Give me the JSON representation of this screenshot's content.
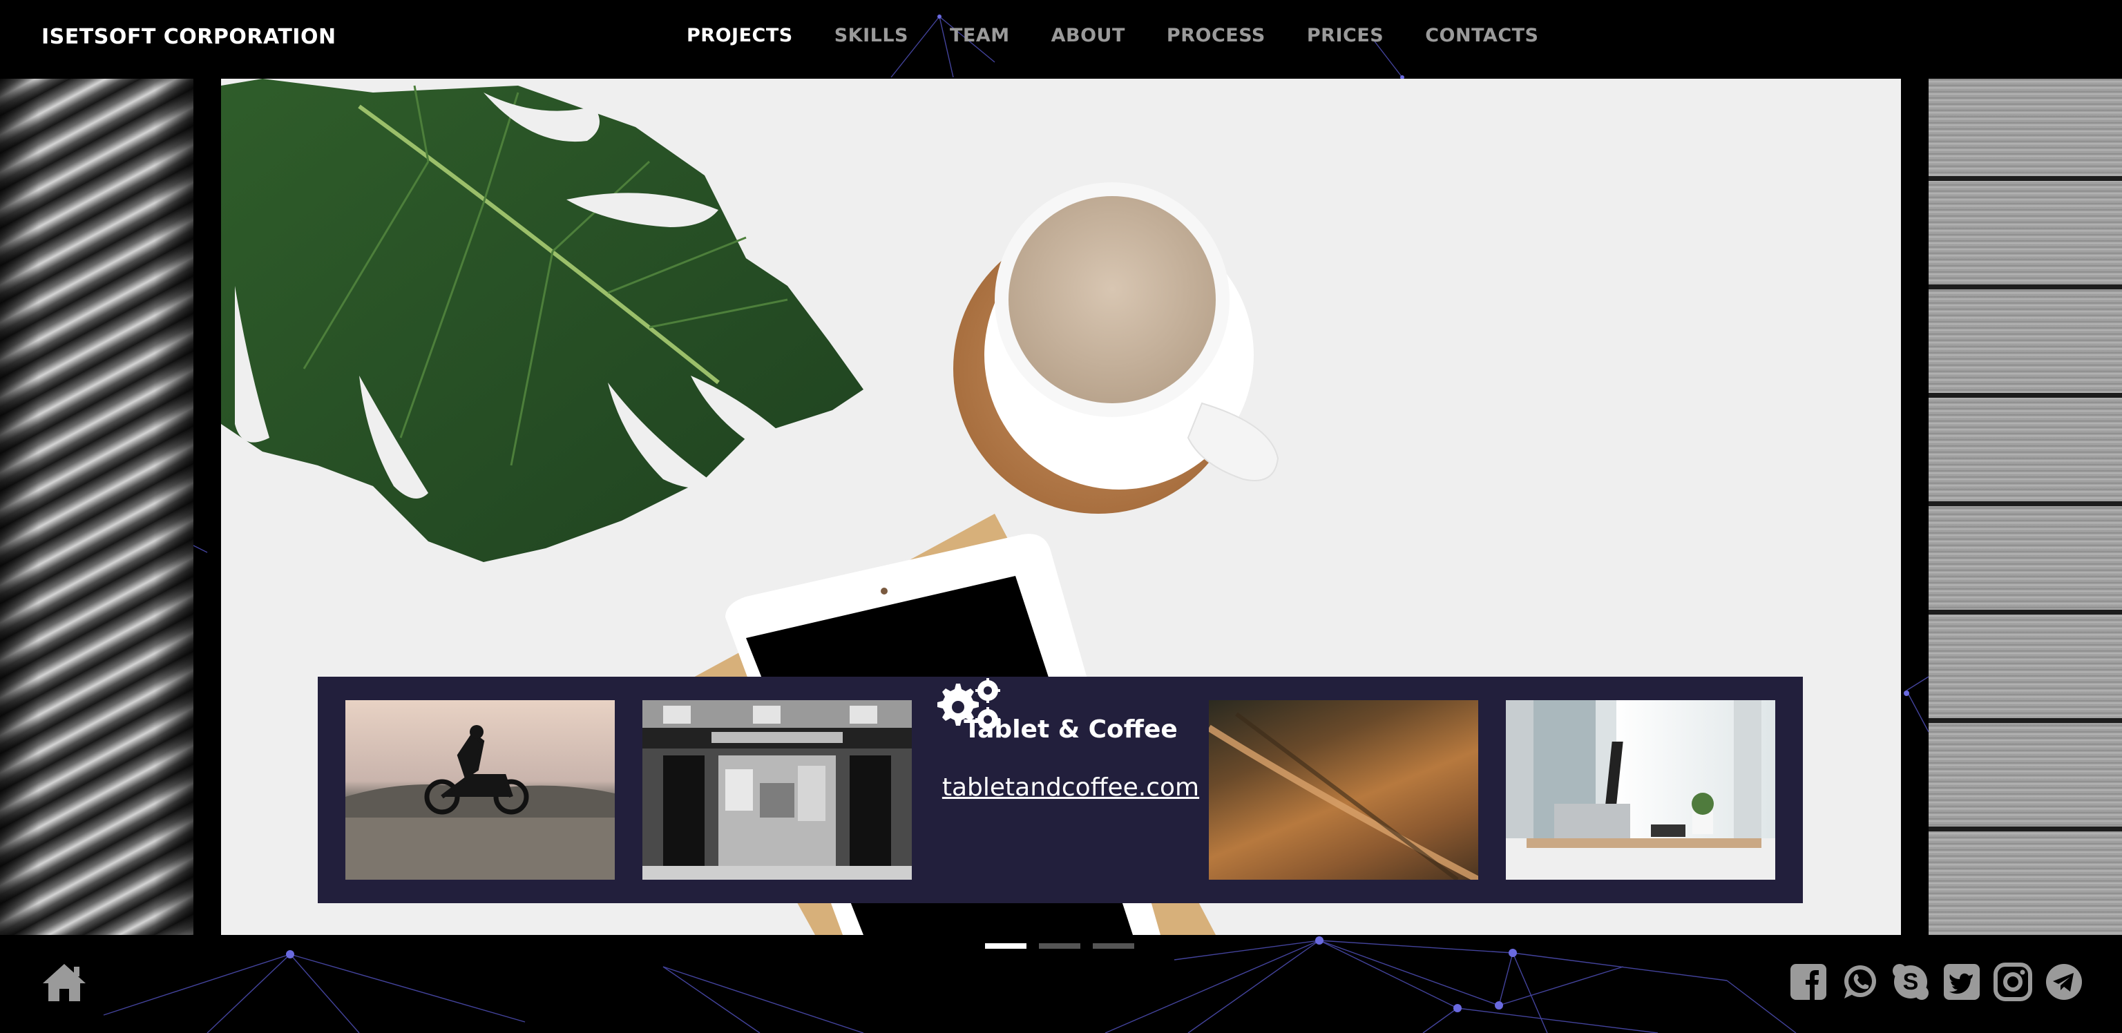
{
  "header": {
    "logo": "ISETSOFT CORPORATION",
    "nav": [
      "PROJECTS",
      "SKILLS",
      "TEAM",
      "ABOUT",
      "PROCESS",
      "PRICES",
      "CONTACTS"
    ],
    "active_nav": "PROJECTS"
  },
  "project": {
    "title": "Tablet & Coffee",
    "link": "tabletandcoffee.com"
  },
  "carousel": {
    "slide_count": 3,
    "active_slide": 1
  },
  "footer": {
    "home_icon": "home-icon",
    "social_icons": [
      "facebook-icon",
      "whatsapp-icon",
      "skype-icon",
      "twitter-icon",
      "instagram-icon",
      "telegram-icon"
    ]
  },
  "colors": {
    "background": "#000000",
    "strip": "#221f3c",
    "network_lines": "#5a5ad0",
    "hero_bg": "#efefef"
  }
}
